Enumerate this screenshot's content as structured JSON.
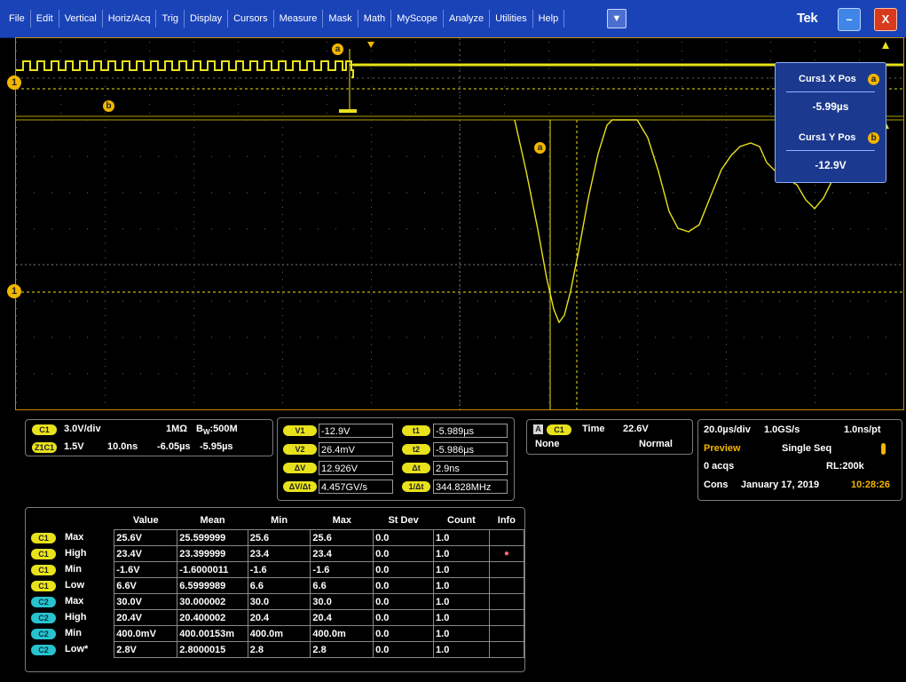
{
  "menu": {
    "items": [
      "File",
      "Edit",
      "Vertical",
      "Horiz/Acq",
      "Trig",
      "Display",
      "Cursors",
      "Measure",
      "Mask",
      "Math",
      "MyScope",
      "Analyze",
      "Utilities",
      "Help"
    ],
    "dropdown_icon": "chevron-down-icon",
    "brand": "Tek",
    "minimize_icon": "minimize-icon",
    "close_icon": "close-icon",
    "minimize_label": "–",
    "close_label": "X"
  },
  "colors": {
    "menubar": "#1a43b8",
    "trace_yellow": "#e8e21c",
    "cyan": "#27c3cf",
    "orange": "#f2b600",
    "border": "#c58a00"
  },
  "scope": {
    "ch1_marker": "1",
    "cursor_a_marker": "a",
    "cursor_b_marker": "b"
  },
  "cursor_readout": {
    "x_title": "Curs1 X Pos",
    "x_badge": "a",
    "x_value": "-5.99µs",
    "y_title": "Curs1 Y Pos",
    "y_badge": "b",
    "y_value": "-12.9V"
  },
  "channel_panel": {
    "c1_pill": "C1",
    "c1_scale": "3.0V/div",
    "c1_coupling": "1MΩ",
    "c1_bw_b": "B",
    "c1_bw_w": "W",
    "c1_bw": ":500M",
    "z1_pill": "Z1C1",
    "z1_scale": "1.5V",
    "z1_time": "10.0ns",
    "z1_start": "-6.05µs",
    "z1_end": "-5.95µs"
  },
  "cursor_panel": {
    "rows": [
      {
        "l_pill": "V1",
        "l_val": "-12.9V",
        "r_pill": "t1",
        "r_val": "-5.989µs"
      },
      {
        "l_pill": "V2",
        "l_val": "26.4mV",
        "r_pill": "t2",
        "r_val": "-5.986µs"
      },
      {
        "l_pill": "ΔV",
        "l_val": "12.926V",
        "r_pill": "Δt",
        "r_val": "2.9ns"
      },
      {
        "l_pill": "ΔV/Δt",
        "l_val": "4.457GV/s",
        "r_pill": "1/Δt",
        "r_val": "344.828MHz"
      }
    ]
  },
  "trigger_panel": {
    "a_box": "A",
    "pill": "C1",
    "label": "Time",
    "level": "22.6V",
    "source": "None",
    "mode": "Normal"
  },
  "acq_panel": {
    "timebase": "20.0µs/div",
    "rate": "1.0GS/s",
    "pt": "1.0ns/pt",
    "preview": "Preview",
    "seq": "Single Seq",
    "acqs": "0 acqs",
    "rl": "RL:200k",
    "cons": "Cons",
    "date": "January 17, 2019",
    "time": "10:28:26",
    "status_icon": "thermometer-icon"
  },
  "measurements": {
    "headers": [
      "Value",
      "Mean",
      "Min",
      "Max",
      "St Dev",
      "Count",
      "Info"
    ],
    "rows": [
      {
        "pill": "C1",
        "type": "y",
        "label": "Max",
        "value": "25.6V",
        "mean": "25.599999",
        "min": "25.6",
        "max": "25.6",
        "stdev": "0.0",
        "count": "1.0",
        "info": ""
      },
      {
        "pill": "C1",
        "type": "y",
        "label": "High",
        "value": "23.4V",
        "mean": "23.399999",
        "min": "23.4",
        "max": "23.4",
        "stdev": "0.0",
        "count": "1.0",
        "info": "●"
      },
      {
        "pill": "C1",
        "type": "y",
        "label": "Min",
        "value": "-1.6V",
        "mean": "-1.6000011",
        "min": "-1.6",
        "max": "-1.6",
        "stdev": "0.0",
        "count": "1.0",
        "info": ""
      },
      {
        "pill": "C1",
        "type": "y",
        "label": "Low",
        "value": "6.6V",
        "mean": "6.5999989",
        "min": "6.6",
        "max": "6.6",
        "stdev": "0.0",
        "count": "1.0",
        "info": ""
      },
      {
        "pill": "C2",
        "type": "c",
        "label": "Max",
        "value": "30.0V",
        "mean": "30.000002",
        "min": "30.0",
        "max": "30.0",
        "stdev": "0.0",
        "count": "1.0",
        "info": ""
      },
      {
        "pill": "C2",
        "type": "c",
        "label": "High",
        "value": "20.4V",
        "mean": "20.400002",
        "min": "20.4",
        "max": "20.4",
        "stdev": "0.0",
        "count": "1.0",
        "info": ""
      },
      {
        "pill": "C2",
        "type": "c",
        "label": "Min",
        "value": "400.0mV",
        "mean": "400.00153m",
        "min": "400.0m",
        "max": "400.0m",
        "stdev": "0.0",
        "count": "1.0",
        "info": ""
      },
      {
        "pill": "C2",
        "type": "c",
        "label": "Low*",
        "value": "2.8V",
        "mean": "2.8000015",
        "min": "2.8",
        "max": "2.8",
        "stdev": "0.0",
        "count": "1.0",
        "info": ""
      }
    ]
  }
}
